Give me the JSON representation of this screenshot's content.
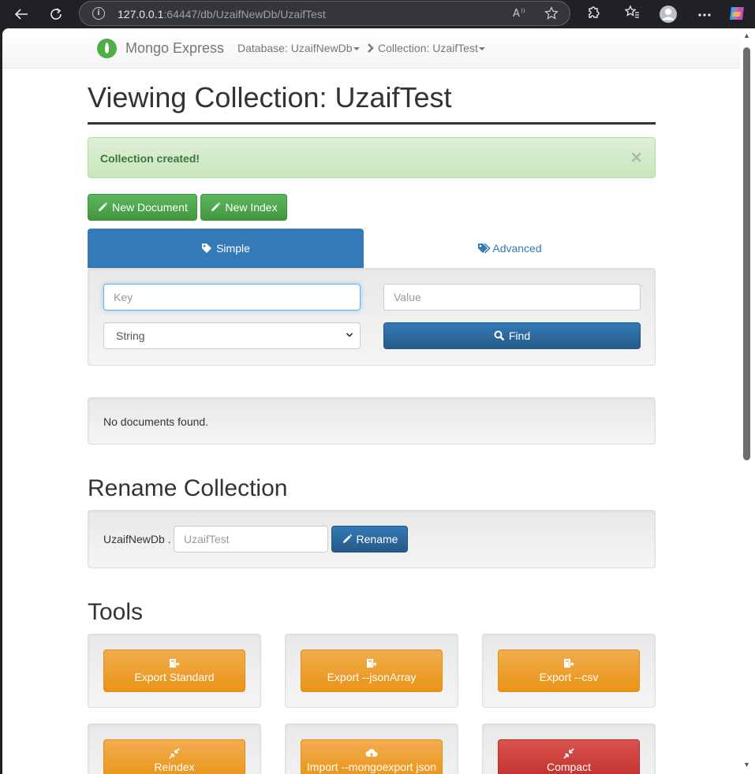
{
  "browser": {
    "url_host": "127.0.0.1",
    "url_rest": ":64447/db/UzaifNewDb/UzaifTest"
  },
  "navbar": {
    "brand": "Mongo Express",
    "database_crumb": "Database: UzaifNewDb",
    "collection_crumb": "Collection: UzaifTest"
  },
  "page": {
    "title": "Viewing Collection: UzaifTest"
  },
  "alert": {
    "message": "Collection created!",
    "close": "×"
  },
  "actions": {
    "new_document": "New Document",
    "new_index": "New Index"
  },
  "search": {
    "tabs": {
      "simple": "Simple",
      "advanced": "Advanced"
    },
    "key_placeholder": "Key",
    "value_placeholder": "Value",
    "type_selected": "String",
    "find_label": "Find"
  },
  "results": {
    "empty_message": "No documents found."
  },
  "rename": {
    "heading": "Rename Collection",
    "db_prefix": "UzaifNewDb .",
    "name_placeholder": "UzaifTest",
    "button": "Rename"
  },
  "tools": {
    "heading": "Tools",
    "buttons": [
      {
        "label": "Export Standard",
        "style": "warning",
        "icon": "export-icon"
      },
      {
        "label": "Export --jsonArray",
        "style": "warning",
        "icon": "export-icon"
      },
      {
        "label": "Export --csv",
        "style": "warning",
        "icon": "export-icon"
      },
      {
        "label": "Reindex",
        "style": "warning",
        "icon": "compress-icon"
      },
      {
        "label": "Import --mongoexport json",
        "style": "warning",
        "icon": "upload-icon"
      },
      {
        "label": "Compact",
        "style": "danger",
        "icon": "compress-icon"
      }
    ]
  },
  "colors": {
    "primary": "#337ab7",
    "success": "#5cb85c",
    "warning": "#f0ad4e",
    "danger": "#d9534f",
    "alert_bg": "#dff0d8"
  }
}
